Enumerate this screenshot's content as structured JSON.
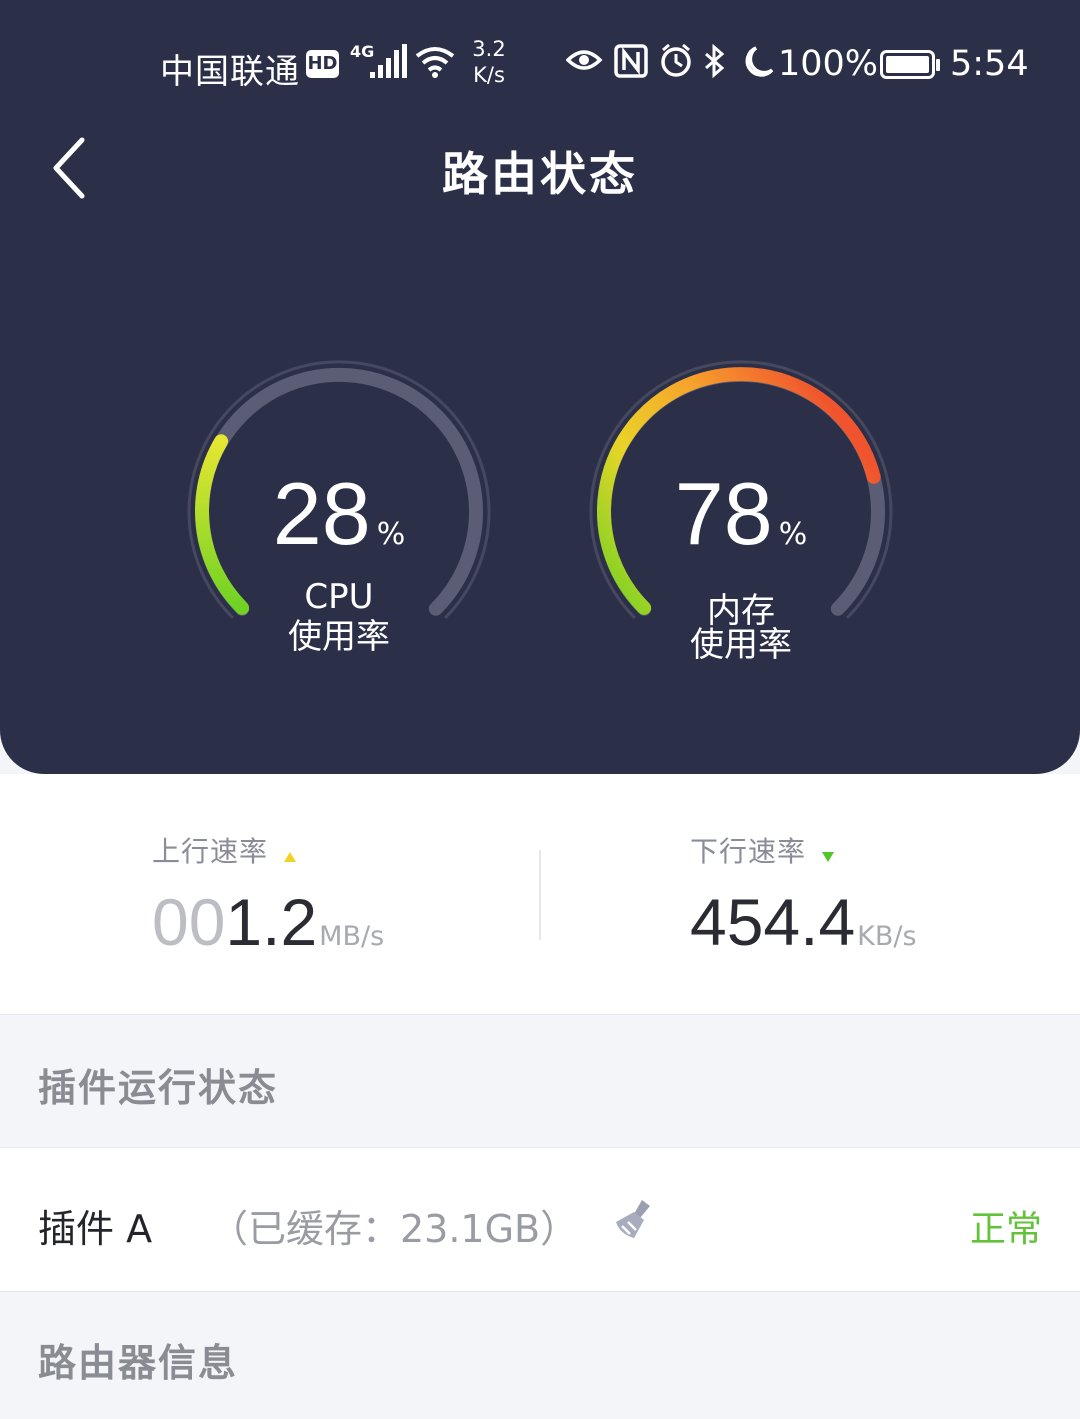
{
  "status_bar": {
    "carrier": "中国联通",
    "hd": "HD",
    "network": "4G",
    "speed_value": "3.2",
    "speed_unit": "K/s",
    "battery": "100%",
    "time": "5:54"
  },
  "header": {
    "title": "路由状态"
  },
  "gauges": {
    "cpu": {
      "value": "28",
      "unit": "%",
      "label_line1": "CPU",
      "label_line2": "使用率",
      "fraction": 0.28
    },
    "memory": {
      "value": "78",
      "unit": "%",
      "label_line1": "内存",
      "label_line2": "使用率",
      "fraction": 0.78
    }
  },
  "speeds": {
    "upload": {
      "label": "上行速率",
      "value_dim": "00",
      "value": "1.2",
      "unit": "MB/s"
    },
    "download": {
      "label": "下行速率",
      "value": "454.4",
      "unit": "KB/s"
    }
  },
  "sections": {
    "plugins_title": "插件运行状态",
    "router_info_title": "路由器信息"
  },
  "plugins": [
    {
      "name": "插件 A",
      "cache": "（已缓存：23.1GB）",
      "status": "正常"
    }
  ],
  "colors": {
    "hero_bg": "#2c2f48",
    "status_ok": "#63c23a",
    "gauge_track": "#5a5d74"
  }
}
